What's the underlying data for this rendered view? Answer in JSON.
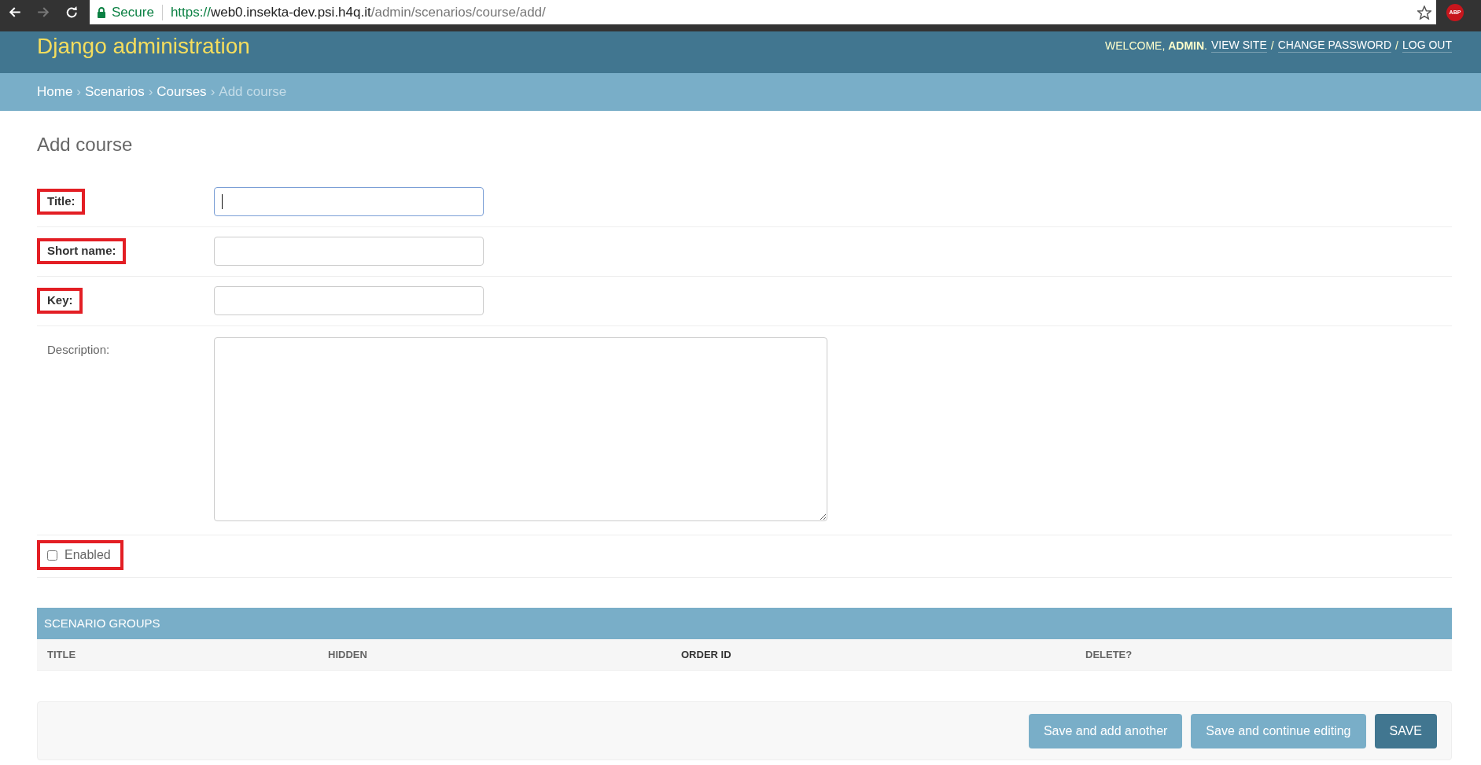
{
  "browser": {
    "nav_buttons": [
      {
        "kind": "back",
        "disabled": false
      },
      {
        "kind": "forward",
        "disabled": true
      },
      {
        "kind": "reload",
        "disabled": false
      }
    ],
    "security_label": "Secure",
    "url": {
      "scheme": "https://",
      "host": "web0.insekta-dev.psi.h4q.it",
      "path": "/admin/scenarios/course/add/"
    },
    "bookmarked": false,
    "extension_badge": "ABP"
  },
  "header": {
    "branding": "Django administration",
    "user_tools": [
      {
        "kind": "text",
        "text": "WELCOME, **ADMIN**."
      },
      {
        "kind": "link",
        "text": "VIEW SITE"
      },
      {
        "kind": "text",
        "text": "/"
      },
      {
        "kind": "link",
        "text": "CHANGE PASSWORD"
      },
      {
        "kind": "text",
        "text": "/"
      },
      {
        "kind": "link",
        "text": "LOG OUT"
      }
    ]
  },
  "breadcrumbs": [
    {
      "kind": "link",
      "text": "Home"
    },
    {
      "kind": "separator",
      "text": "›"
    },
    {
      "kind": "link",
      "text": "Scenarios"
    },
    {
      "kind": "separator",
      "text": "›"
    },
    {
      "kind": "link",
      "text": "Courses"
    },
    {
      "kind": "separator",
      "text": "›"
    },
    {
      "kind": "current",
      "text": "Add course"
    }
  ],
  "page_title": "Add course",
  "form": {
    "fields": [
      {
        "kind": "text",
        "label": "Title:",
        "required": true,
        "highlighted": true,
        "focused": true
      },
      {
        "kind": "text",
        "label": "Short name:",
        "required": true,
        "highlighted": true,
        "focused": false
      },
      {
        "kind": "text",
        "label": "Key:",
        "required": true,
        "highlighted": true,
        "focused": false
      },
      {
        "kind": "textarea",
        "label": "Description:",
        "required": false,
        "highlighted": false,
        "focused": false
      },
      {
        "kind": "checkbox",
        "label": "Enabled",
        "required": false,
        "highlighted": true,
        "focused": false,
        "checked": false
      }
    ]
  },
  "inline_group": {
    "title": "SCENARIO GROUPS",
    "columns": [
      {
        "label": "TITLE",
        "required": false
      },
      {
        "label": "HIDDEN",
        "required": false
      },
      {
        "label": "ORDER ID",
        "required": true
      },
      {
        "label": "DELETE?",
        "required": false
      }
    ]
  },
  "submit_row": {
    "buttons": [
      {
        "label": "Save and add another",
        "primary": false
      },
      {
        "label": "Save and continue editing",
        "primary": false
      },
      {
        "label": "SAVE",
        "primary": true
      }
    ]
  }
}
